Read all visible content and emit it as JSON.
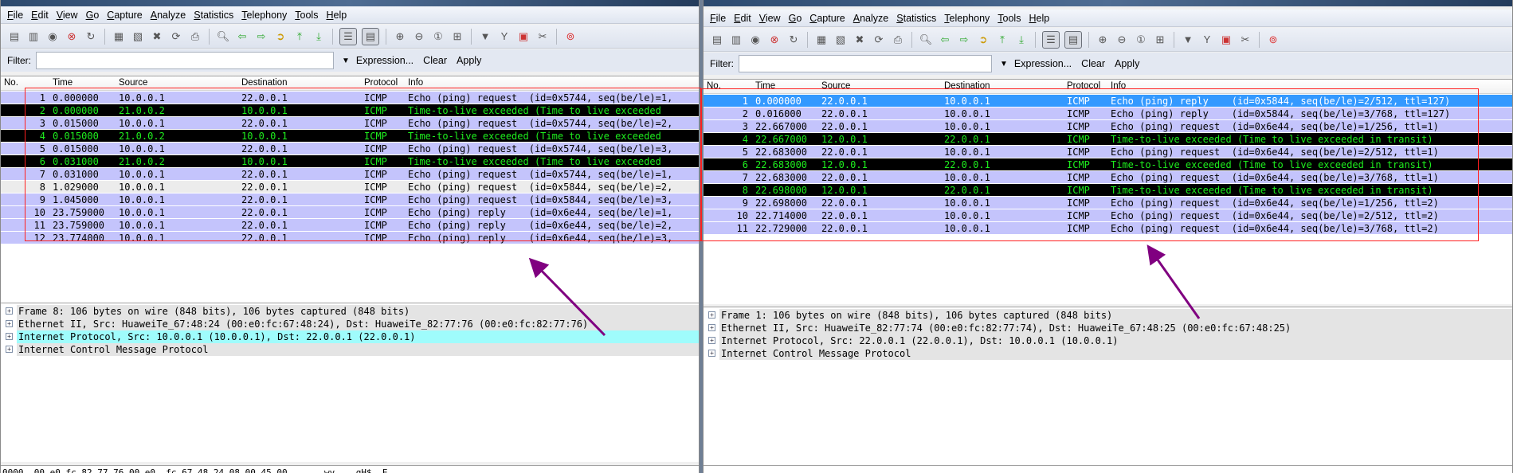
{
  "colors": {
    "row_default": "#c4c4fc",
    "row_alt": "#ececec",
    "row_ttl_bg": "#000000",
    "row_ttl_fg": "#1eee1e",
    "selected": "#3399ff",
    "detail_highlight": "#9ffcfc",
    "annotation_box": "#ff2020",
    "annotation_arrow": "#800080"
  },
  "menu": [
    "File",
    "Edit",
    "View",
    "Go",
    "Capture",
    "Analyze",
    "Statistics",
    "Telephony",
    "Tools",
    "Help"
  ],
  "toolbar_icons": [
    "interface-list-icon",
    "capture-options-icon",
    "start-capture-icon",
    "stop-capture-icon",
    "restart-capture-icon",
    "|",
    "open-file-icon",
    "save-file-icon",
    "close-file-icon",
    "reload-icon",
    "print-icon",
    "|",
    "find-packet-icon",
    "go-back-icon",
    "go-forward-icon",
    "go-to-packet-icon",
    "go-first-icon",
    "go-last-icon",
    "|",
    "colorize-icon",
    "auto-scroll-icon",
    "|",
    "zoom-in-icon",
    "zoom-out-icon",
    "zoom-normal-icon",
    "resize-columns-icon",
    "|",
    "capture-filters-icon",
    "display-filters-icon",
    "coloring-rules-icon",
    "preferences-icon",
    "|",
    "help-icon"
  ],
  "filter": {
    "label": "Filter:",
    "value": "",
    "expression": "Expression...",
    "clear": "Clear",
    "apply": "Apply"
  },
  "columns": [
    "No.",
    "Time",
    "Source",
    "Destination",
    "Protocol",
    "Info"
  ],
  "left": {
    "packets": [
      {
        "no": "1",
        "time": "0.000000",
        "src": "10.0.0.1",
        "dst": "22.0.0.1",
        "proto": "ICMP",
        "info": "Echo (ping) request  (id=0x5744, seq(be/le)=1,",
        "style": "default"
      },
      {
        "no": "2",
        "time": "0.000000",
        "src": "21.0.0.2",
        "dst": "10.0.0.1",
        "proto": "ICMP",
        "info": "Time-to-live exceeded (Time to live exceeded",
        "style": "ttl"
      },
      {
        "no": "3",
        "time": "0.015000",
        "src": "10.0.0.1",
        "dst": "22.0.0.1",
        "proto": "ICMP",
        "info": "Echo (ping) request  (id=0x5744, seq(be/le)=2,",
        "style": "default"
      },
      {
        "no": "4",
        "time": "0.015000",
        "src": "21.0.0.2",
        "dst": "10.0.0.1",
        "proto": "ICMP",
        "info": "Time-to-live exceeded (Time to live exceeded",
        "style": "ttl"
      },
      {
        "no": "5",
        "time": "0.015000",
        "src": "10.0.0.1",
        "dst": "22.0.0.1",
        "proto": "ICMP",
        "info": "Echo (ping) request  (id=0x5744, seq(be/le)=3,",
        "style": "default"
      },
      {
        "no": "6",
        "time": "0.031000",
        "src": "21.0.0.2",
        "dst": "10.0.0.1",
        "proto": "ICMP",
        "info": "Time-to-live exceeded (Time to live exceeded",
        "style": "ttl"
      },
      {
        "no": "7",
        "time": "0.031000",
        "src": "10.0.0.1",
        "dst": "22.0.0.1",
        "proto": "ICMP",
        "info": "Echo (ping) request  (id=0x5744, seq(be/le)=1,",
        "style": "default"
      },
      {
        "no": "8",
        "time": "1.029000",
        "src": "10.0.0.1",
        "dst": "22.0.0.1",
        "proto": "ICMP",
        "info": "Echo (ping) request  (id=0x5844, seq(be/le)=2,",
        "style": "alt"
      },
      {
        "no": "9",
        "time": "1.045000",
        "src": "10.0.0.1",
        "dst": "22.0.0.1",
        "proto": "ICMP",
        "info": "Echo (ping) request  (id=0x5844, seq(be/le)=3,",
        "style": "default"
      },
      {
        "no": "10",
        "time": "23.759000",
        "src": "10.0.0.1",
        "dst": "22.0.0.1",
        "proto": "ICMP",
        "info": "Echo (ping) reply    (id=0x6e44, seq(be/le)=1,",
        "style": "default"
      },
      {
        "no": "11",
        "time": "23.759000",
        "src": "10.0.0.1",
        "dst": "22.0.0.1",
        "proto": "ICMP",
        "info": "Echo (ping) reply    (id=0x6e44, seq(be/le)=2,",
        "style": "default"
      },
      {
        "no": "12",
        "time": "23.774000",
        "src": "10.0.0.1",
        "dst": "22.0.0.1",
        "proto": "ICMP",
        "info": "Echo (ping) reply    (id=0x6e44, seq(be/le)=3,",
        "style": "default"
      }
    ],
    "details": [
      {
        "text": "Frame 8: 106 bytes on wire (848 bits), 106 bytes captured (848 bits)",
        "highlight": false
      },
      {
        "text": "Ethernet II, Src: HuaweiTe_67:48:24 (00:e0:fc:67:48:24), Dst: HuaweiTe_82:77:76 (00:e0:fc:82:77:76)",
        "highlight": false
      },
      {
        "text": "Internet Protocol, Src: 10.0.0.1 (10.0.0.1), Dst: 22.0.0.1 (22.0.0.1)",
        "highlight": true
      },
      {
        "text": "Internet Control Message Protocol",
        "highlight": false
      }
    ],
    "hex": "0000  00 e0 fc 82 77 76 00 e0  fc 67 48 24 08 00 45 00   ....wv.. .gH$..E."
  },
  "right": {
    "packets": [
      {
        "no": "1",
        "time": "0.000000",
        "src": "22.0.0.1",
        "dst": "10.0.0.1",
        "proto": "ICMP",
        "info": "Echo (ping) reply    (id=0x5844, seq(be/le)=2/512, ttl=127)",
        "style": "selected"
      },
      {
        "no": "2",
        "time": "0.016000",
        "src": "22.0.0.1",
        "dst": "10.0.0.1",
        "proto": "ICMP",
        "info": "Echo (ping) reply    (id=0x5844, seq(be/le)=3/768, ttl=127)",
        "style": "default"
      },
      {
        "no": "3",
        "time": "22.667000",
        "src": "22.0.0.1",
        "dst": "10.0.0.1",
        "proto": "ICMP",
        "info": "Echo (ping) request  (id=0x6e44, seq(be/le)=1/256, ttl=1)",
        "style": "default"
      },
      {
        "no": "4",
        "time": "22.667000",
        "src": "12.0.0.1",
        "dst": "22.0.0.1",
        "proto": "ICMP",
        "info": "Time-to-live exceeded (Time to live exceeded in transit)",
        "style": "ttl"
      },
      {
        "no": "5",
        "time": "22.683000",
        "src": "22.0.0.1",
        "dst": "10.0.0.1",
        "proto": "ICMP",
        "info": "Echo (ping) request  (id=0x6e44, seq(be/le)=2/512, ttl=1)",
        "style": "default"
      },
      {
        "no": "6",
        "time": "22.683000",
        "src": "12.0.0.1",
        "dst": "22.0.0.1",
        "proto": "ICMP",
        "info": "Time-to-live exceeded (Time to live exceeded in transit)",
        "style": "ttl"
      },
      {
        "no": "7",
        "time": "22.683000",
        "src": "22.0.0.1",
        "dst": "10.0.0.1",
        "proto": "ICMP",
        "info": "Echo (ping) request  (id=0x6e44, seq(be/le)=3/768, ttl=1)",
        "style": "default"
      },
      {
        "no": "8",
        "time": "22.698000",
        "src": "12.0.0.1",
        "dst": "22.0.0.1",
        "proto": "ICMP",
        "info": "Time-to-live exceeded (Time to live exceeded in transit)",
        "style": "ttl"
      },
      {
        "no": "9",
        "time": "22.698000",
        "src": "22.0.0.1",
        "dst": "10.0.0.1",
        "proto": "ICMP",
        "info": "Echo (ping) request  (id=0x6e44, seq(be/le)=1/256, ttl=2)",
        "style": "default"
      },
      {
        "no": "10",
        "time": "22.714000",
        "src": "22.0.0.1",
        "dst": "10.0.0.1",
        "proto": "ICMP",
        "info": "Echo (ping) request  (id=0x6e44, seq(be/le)=2/512, ttl=2)",
        "style": "default"
      },
      {
        "no": "11",
        "time": "22.729000",
        "src": "22.0.0.1",
        "dst": "10.0.0.1",
        "proto": "ICMP",
        "info": "Echo (ping) request  (id=0x6e44, seq(be/le)=3/768, ttl=2)",
        "style": "default"
      }
    ],
    "details": [
      {
        "text": "Frame 1: 106 bytes on wire (848 bits), 106 bytes captured (848 bits)",
        "highlight": false
      },
      {
        "text": "Ethernet II, Src: HuaweiTe_82:77:74 (00:e0:fc:82:77:74), Dst: HuaweiTe_67:48:25 (00:e0:fc:67:48:25)",
        "highlight": false
      },
      {
        "text": "Internet Protocol, Src: 22.0.0.1 (22.0.0.1), Dst: 10.0.0.1 (10.0.0.1)",
        "highlight": false
      },
      {
        "text": "Internet Control Message Protocol",
        "highlight": false
      }
    ]
  }
}
